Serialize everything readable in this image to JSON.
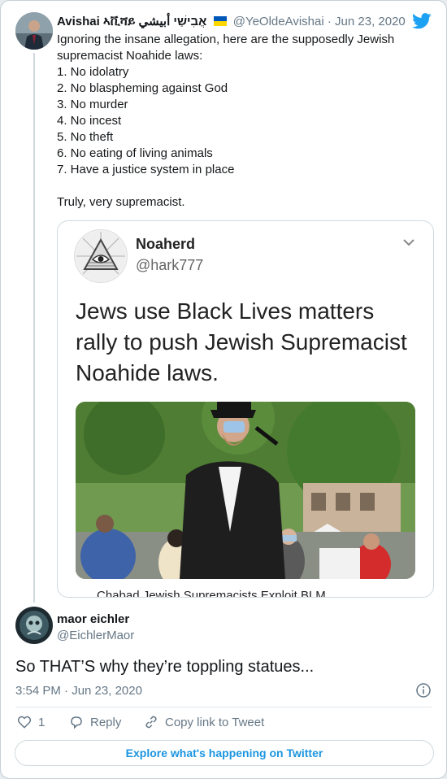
{
  "tweet": {
    "author_name": "Avishai ኣቪሻይ אֲבִישַׁי أبيشي",
    "author_handle": "@YeOldeAvishai",
    "date": "· Jun 23, 2020",
    "text": "Ignoring the insane allegation, here are the supposedly Jewish supremacist Noahide laws:\n1. No idolatry\n2. No blaspheming against God\n3. No murder\n4. No incest\n5. No theft\n6. No eating of living animals\n7. Have a justice system in place\n\nTruly, very supremacist.",
    "icons": {
      "flag": "ukraine-flag-icon",
      "brand": "twitter-bird-icon"
    },
    "colors": {
      "brand": "#1da1f2",
      "flag_blue": "#0057b7",
      "flag_yellow": "#ffd700"
    }
  },
  "quote": {
    "author_name": "Noaherd",
    "author_handle": "@hark777",
    "headline": "Jews use Black Lives matters rally to push Jewish Supremacist Noahide laws.",
    "cut_caption": "Chabad Jewish Supremacists Exploit BLM ..."
  },
  "reply": {
    "author_name": "maor eichler",
    "author_handle": "@EichlerMaor",
    "text": "So THAT’S why they’re toppling statues...",
    "timestamp": "3:54 PM · Jun 23, 2020",
    "like_count": "1",
    "reply_label": "Reply",
    "copy_label": "Copy link to Tweet"
  },
  "explore_label": "Explore what's happening on Twitter"
}
